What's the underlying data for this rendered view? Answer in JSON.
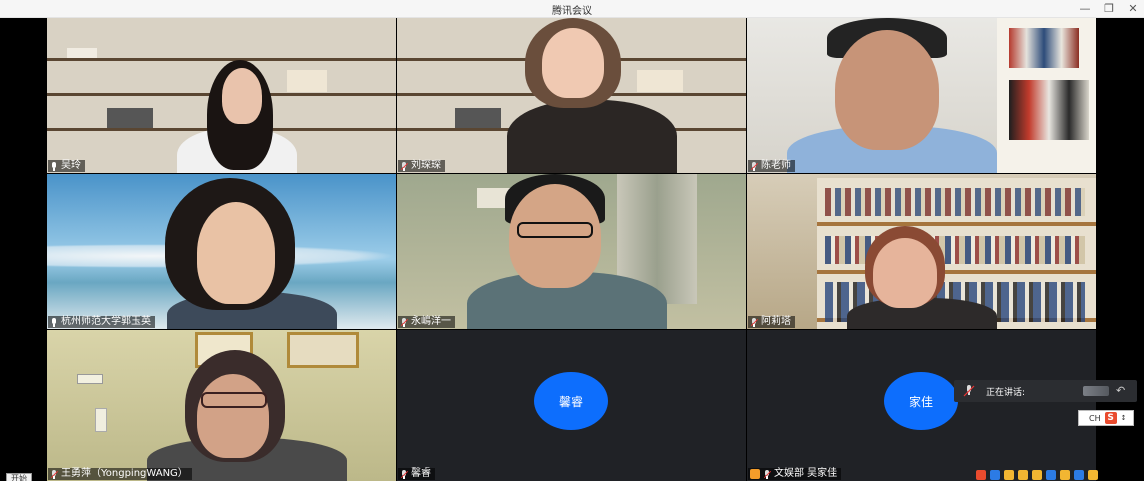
{
  "window": {
    "title": "腾讯会议",
    "controls": [
      "—",
      "❐",
      "✕"
    ]
  },
  "participants": [
    {
      "name": "吴玲",
      "mic": "on",
      "video": true
    },
    {
      "name": "刘琛琛",
      "mic": "muted",
      "video": true
    },
    {
      "name": "陈老师",
      "mic": "muted",
      "video": true
    },
    {
      "name": "杭州师范大学郭玉英",
      "mic": "on",
      "video": true
    },
    {
      "name": "永嶋洋一",
      "mic": "muted",
      "video": true
    },
    {
      "name": "阿莉塔",
      "mic": "muted",
      "video": true
    },
    {
      "name": "王勇萍（YongpingWANG）",
      "mic": "muted",
      "video": true
    },
    {
      "name": "馨睿",
      "mic": "muted",
      "video": false,
      "avatar_text": "馨睿"
    },
    {
      "name": "文娱部 吴家佳",
      "mic": "muted",
      "video": false,
      "avatar_text": "家佳"
    }
  ],
  "speaker_panel": {
    "label": "正在讲话:"
  },
  "ime": {
    "label": "CH",
    "logo": "S"
  },
  "taskbar": {
    "start_label": "开始"
  },
  "colors": {
    "avatar_blue": "#0d6efd",
    "tile_empty": "#202226",
    "titlebar": "#f6f6f6"
  }
}
